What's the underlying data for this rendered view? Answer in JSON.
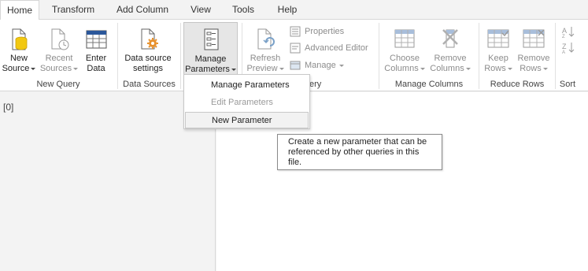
{
  "tabs": [
    "Home",
    "Transform",
    "Add Column",
    "View",
    "Tools",
    "Help"
  ],
  "ribbon": {
    "new_source": {
      "line1": "New",
      "line2": "Source"
    },
    "recent_sources": {
      "line1": "Recent",
      "line2": "Sources"
    },
    "enter_data": {
      "line1": "Enter",
      "line2": "Data"
    },
    "data_source_settings": {
      "line1": "Data source",
      "line2": "settings"
    },
    "manage_parameters": {
      "line1": "Manage",
      "line2": "Parameters"
    },
    "refresh_preview": {
      "line1": "Refresh",
      "line2": "Preview"
    },
    "properties": "Properties",
    "advanced_editor": "Advanced Editor",
    "manage": "Manage",
    "choose_columns": {
      "line1": "Choose",
      "line2": "Columns"
    },
    "remove_columns": {
      "line1": "Remove",
      "line2": "Columns"
    },
    "keep_rows": {
      "line1": "Keep",
      "line2": "Rows"
    },
    "remove_rows": {
      "line1": "Remove",
      "line2": "Rows"
    },
    "groups": {
      "new_query": "New Query",
      "data_sources": "Data Sources",
      "query": "ery",
      "manage_columns": "Manage Columns",
      "reduce_rows": "Reduce Rows",
      "sort": "Sort"
    }
  },
  "query_list": {
    "index": "[0]"
  },
  "dropdown": {
    "items": [
      "Manage Parameters",
      "Edit Parameters",
      "New Parameter"
    ]
  },
  "tooltip": {
    "line1": "Create a new parameter that can be",
    "line2": "referenced by other queries in this",
    "line3": "file."
  },
  "colors": {
    "accent_yellow": "#f2c811",
    "orange": "#e8912d",
    "blue_icon": "#2b579a",
    "disabled": "#8c8c8c"
  }
}
